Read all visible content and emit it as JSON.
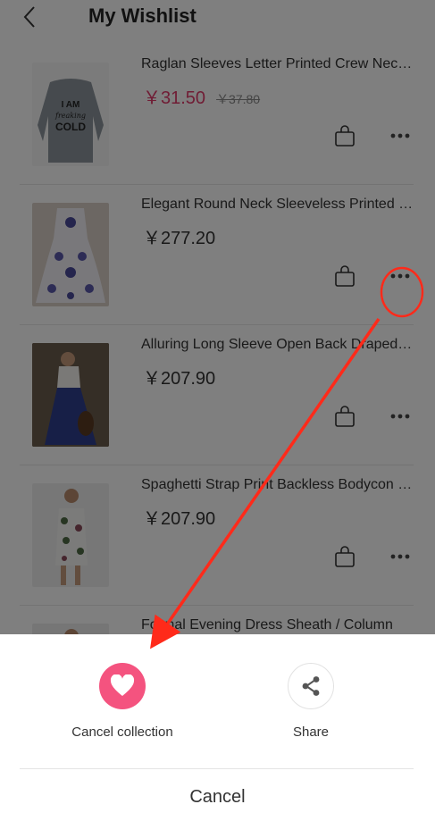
{
  "header": {
    "title": "My Wishlist"
  },
  "wishlist": [
    {
      "name": "Raglan Sleeves Letter Printed Crew Neck Sweatshirt",
      "price": "￥31.50",
      "original_price": "￥37.80",
      "sale": true
    },
    {
      "name": "Elegant Round Neck Sleeveless Printed Dress",
      "price": "￥277.20",
      "original_price": "",
      "sale": false
    },
    {
      "name": "Alluring Long Sleeve Open Back Draped Dress",
      "price": "￥207.90",
      "original_price": "",
      "sale": false
    },
    {
      "name": "Spaghetti Strap Print Backless Bodycon Dress",
      "price": "￥207.90",
      "original_price": "",
      "sale": false
    },
    {
      "name": "Formal Evening Dress Sheath / Column",
      "price": "",
      "original_price": "",
      "sale": false
    }
  ],
  "sweatshirt_print": [
    "I AM",
    "freaking",
    "COLD"
  ],
  "sheet": {
    "cancel_collection_label": "Cancel collection",
    "share_label": "Share",
    "cancel_label": "Cancel"
  },
  "colors": {
    "accent_pink": "#f4537f",
    "sale_price": "#e03a6a",
    "annotation_red": "#ff2a1a"
  },
  "icons": [
    "back-icon",
    "bag-icon",
    "more-icon",
    "heart-icon",
    "share-icon"
  ]
}
